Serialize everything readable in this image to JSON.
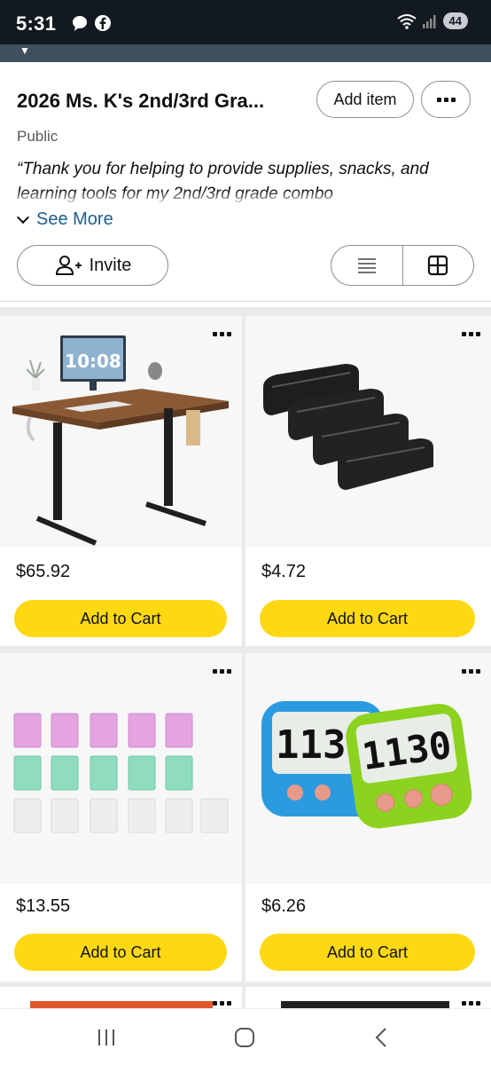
{
  "status_bar": {
    "time": "5:31",
    "battery_level": "44",
    "icons": [
      "chat-bubble-icon",
      "facebook-icon",
      "wifi-icon",
      "signal-icon"
    ]
  },
  "list": {
    "title": "2026 Ms. K's 2nd/3rd Gra...",
    "add_item_label": "Add item",
    "privacy": "Public",
    "description": "“Thank you for helping to provide supplies, snacks, and learning tools for my 2nd/3rd grade combo",
    "see_more_label": "See More",
    "invite_label": "Invite"
  },
  "products": [
    {
      "name": "standing-desk",
      "price": "$65.92",
      "cart_label": "Add to Cart",
      "screen_text": "10:08"
    },
    {
      "name": "whiteboard-erasers",
      "price": "$4.72",
      "cart_label": "Add to Cart"
    },
    {
      "name": "pencil-boxes",
      "price": "$13.55",
      "cart_label": "Add to Cart"
    },
    {
      "name": "digital-timers",
      "price": "$6.26",
      "cart_label": "Add to Cart",
      "timer_digits": "1130"
    }
  ],
  "colors": {
    "status_bar_bg": "#131921",
    "cart_button": "#FFD814",
    "link": "#1D5E8C",
    "grid_bg": "#E9EBEB"
  }
}
